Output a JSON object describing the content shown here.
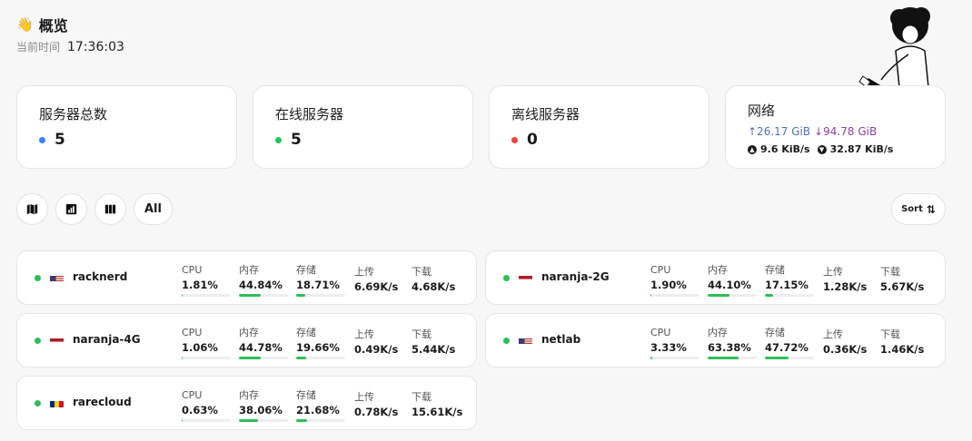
{
  "header": {
    "wave_emoji": "👋",
    "title": "概览",
    "time_label": "当前时间",
    "time_value": "17:36:03"
  },
  "stats": [
    {
      "label": "服务器总数",
      "value": "5",
      "color": "#3b82f6"
    },
    {
      "label": "在线服务器",
      "value": "5",
      "color": "#22c55e"
    },
    {
      "label": "离线服务器",
      "value": "0",
      "color": "#ef4444"
    }
  ],
  "network": {
    "label": "网络",
    "upload_total": "↑26.17 GiB",
    "download_total": "↓94.78 GiB",
    "upload_speed": "9.6 KiB/s",
    "download_speed": "32.87 KiB/s"
  },
  "toolbar": {
    "all_label": "All",
    "sort_label": "Sort",
    "icons": [
      "map-icon",
      "chart-icon",
      "columns-icon"
    ]
  },
  "metric_labels": {
    "cpu": "CPU",
    "mem": "内存",
    "disk": "存储",
    "up": "上传",
    "down": "下载"
  },
  "servers": [
    {
      "name": "racknerd",
      "flag": "us",
      "cpu": "1.81%",
      "cpu_pct": 1.81,
      "mem": "44.84%",
      "mem_pct": 44.84,
      "disk": "18.71%",
      "disk_pct": 18.71,
      "up": "6.69K/s",
      "down": "4.68K/s"
    },
    {
      "name": "naranja-2G",
      "flag": "nl",
      "cpu": "1.90%",
      "cpu_pct": 1.9,
      "mem": "44.10%",
      "mem_pct": 44.1,
      "disk": "17.15%",
      "disk_pct": 17.15,
      "up": "1.28K/s",
      "down": "5.67K/s"
    },
    {
      "name": "naranja-4G",
      "flag": "nl",
      "cpu": "1.06%",
      "cpu_pct": 1.06,
      "mem": "44.78%",
      "mem_pct": 44.78,
      "disk": "19.66%",
      "disk_pct": 19.66,
      "up": "0.49K/s",
      "down": "5.44K/s"
    },
    {
      "name": "netlab",
      "flag": "us",
      "cpu": "3.33%",
      "cpu_pct": 3.33,
      "mem": "63.38%",
      "mem_pct": 63.38,
      "disk": "47.72%",
      "disk_pct": 47.72,
      "up": "0.36K/s",
      "down": "1.46K/s"
    },
    {
      "name": "rarecloud",
      "flag": "ro",
      "cpu": "0.63%",
      "cpu_pct": 0.63,
      "mem": "38.06%",
      "mem_pct": 38.06,
      "disk": "21.68%",
      "disk_pct": 21.68,
      "up": "0.78K/s",
      "down": "15.61K/s"
    }
  ]
}
